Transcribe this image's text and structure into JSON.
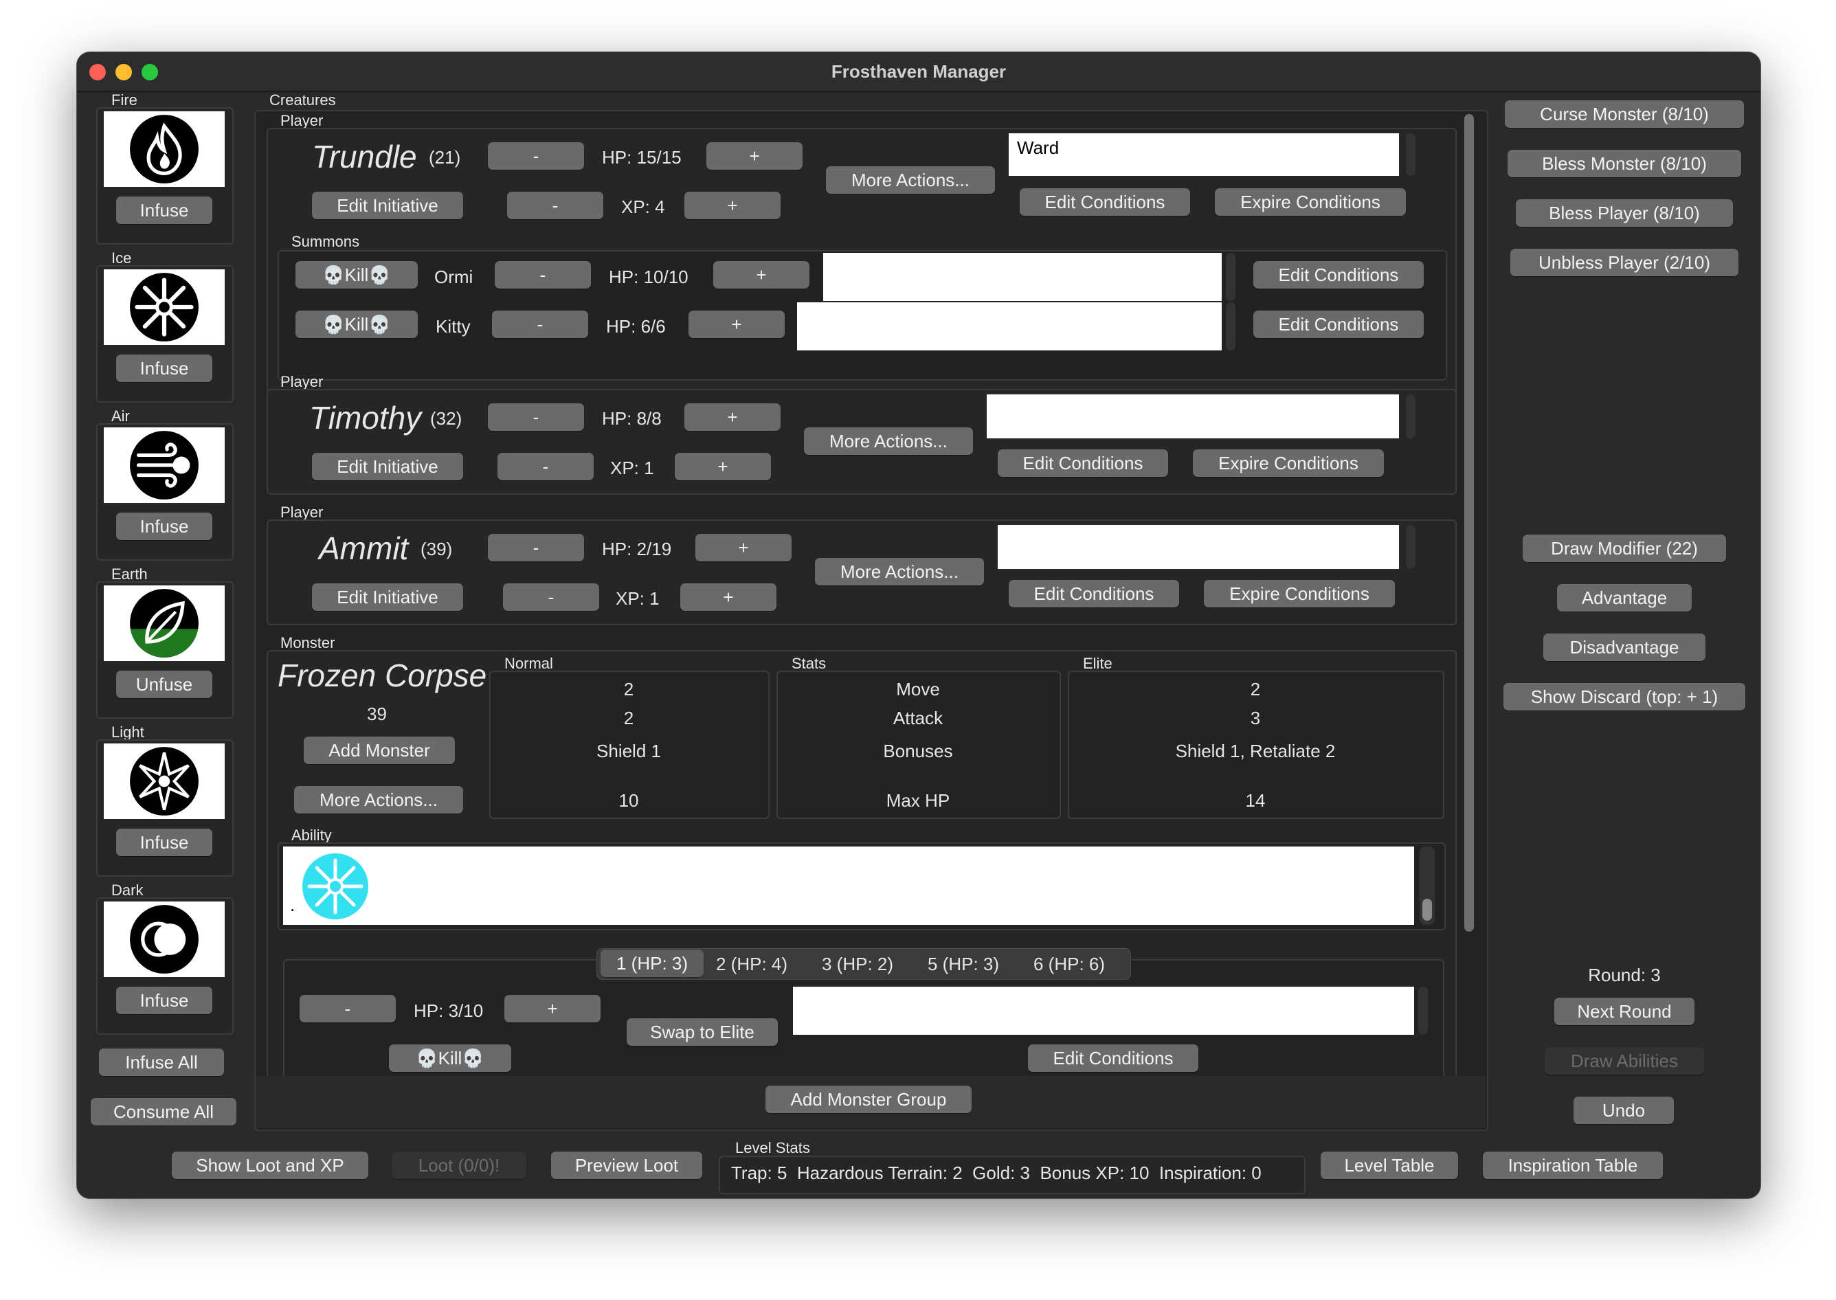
{
  "window": {
    "title": "Frosthaven Manager"
  },
  "elements": [
    {
      "label": "Fire",
      "button": "Infuse"
    },
    {
      "label": "Ice",
      "button": "Infuse"
    },
    {
      "label": "Air",
      "button": "Infuse"
    },
    {
      "label": "Earth",
      "button": "Unfuse"
    },
    {
      "label": "Light",
      "button": "Infuse"
    },
    {
      "label": "Dark",
      "button": "Infuse"
    }
  ],
  "element_actions": {
    "infuse_all": "Infuse All",
    "consume_all": "Consume All"
  },
  "creatures_label": "Creatures",
  "players": [
    {
      "section": "Player",
      "name": "Trundle",
      "initiative": "(21)",
      "hp": "HP: 15/15",
      "xp": "XP: 4",
      "conditions": "Ward",
      "more_actions": "More Actions...",
      "edit_initiative": "Edit Initiative",
      "edit_conditions": "Edit Conditions",
      "expire_conditions": "Expire Conditions",
      "minus": "-",
      "plus": "+",
      "summons_label": "Summons",
      "summons": [
        {
          "kill": "Kill",
          "name": "Ormi",
          "hp": "HP: 10/10",
          "edit_conditions": "Edit Conditions"
        },
        {
          "kill": "Kill",
          "name": "Kitty",
          "hp": "HP: 6/6",
          "edit_conditions": "Edit Conditions"
        }
      ]
    },
    {
      "section": "Player",
      "name": "Timothy",
      "initiative": "(32)",
      "hp": "HP: 8/8",
      "xp": "XP: 1",
      "conditions": "",
      "more_actions": "More Actions...",
      "edit_initiative": "Edit Initiative",
      "edit_conditions": "Edit Conditions",
      "expire_conditions": "Expire Conditions",
      "minus": "-",
      "plus": "+"
    },
    {
      "section": "Player",
      "name": "Ammit",
      "initiative": "(39)",
      "hp": "HP: 2/19",
      "xp": "XP: 1",
      "conditions": "",
      "more_actions": "More Actions...",
      "edit_initiative": "Edit Initiative",
      "edit_conditions": "Edit Conditions",
      "expire_conditions": "Expire Conditions",
      "minus": "-",
      "plus": "+"
    }
  ],
  "monster": {
    "section": "Monster",
    "name": "Frozen Corpse",
    "initiative": "39",
    "add_monster": "Add Monster",
    "more_actions": "More Actions...",
    "normal_label": "Normal",
    "stats_label": "Stats",
    "elite_label": "Elite",
    "normal": [
      "2",
      "2",
      "Shield 1",
      "10"
    ],
    "stats": [
      "Move",
      "Attack",
      "Bonuses",
      "Max HP"
    ],
    "elite": [
      "2",
      "3",
      "Shield 1, Retaliate 2",
      "14"
    ],
    "ability_label": "Ability",
    "ability_text": ".",
    "ability_icon": "ice-element-icon",
    "tabs": [
      "1 (HP: 3)",
      "2 (HP: 4)",
      "3 (HP: 2)",
      "5 (HP: 3)",
      "6 (HP: 6)"
    ],
    "selected": {
      "minus": "-",
      "hp": "HP: 3/10",
      "plus": "+",
      "swap": "Swap to Elite",
      "kill": "Kill",
      "conditions": "",
      "edit_conditions": "Edit Conditions"
    }
  },
  "add_monster_group": "Add Monster Group",
  "right": {
    "curse_monster": "Curse Monster (8/10)",
    "bless_monster": "Bless Monster (8/10)",
    "bless_player": "Bless Player (8/10)",
    "unbless_player": "Unbless Player (2/10)",
    "draw_modifier": "Draw Modifier (22)",
    "advantage": "Advantage",
    "disadvantage": "Disadvantage",
    "show_discard": "Show Discard (top: + 1)",
    "round": "Round: 3",
    "next_round": "Next Round",
    "draw_abilities": "Draw Abilities",
    "undo": "Undo"
  },
  "bottom": {
    "show_loot": "Show Loot and XP",
    "loot": "Loot (0/0)!",
    "preview_loot": "Preview Loot",
    "level_stats_label": "Level Stats",
    "level_stats": "Trap: 5  Hazardous Terrain: 2  Gold: 3  Bonus XP: 10  Inspiration: 0",
    "level_table": "Level Table",
    "inspiration_table": "Inspiration Table"
  },
  "colors": {
    "window_bg": "#2a2a2a",
    "button": "#6a6a6a",
    "ice_accent": "#33e0f0",
    "earth_accent": "#1f7a1f"
  }
}
